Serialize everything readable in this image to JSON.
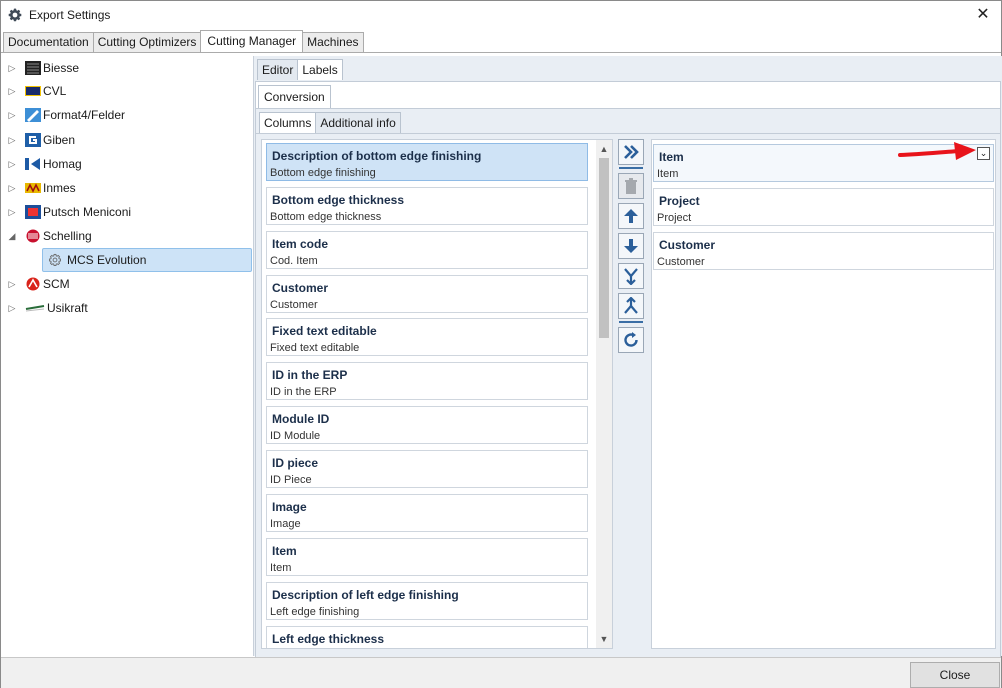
{
  "window": {
    "title": "Export Settings"
  },
  "top_tabs": [
    "Documentation",
    "Cutting Optimizers",
    "Cutting Manager",
    "Machines"
  ],
  "top_tab_active": "Cutting Manager",
  "tree": {
    "items": [
      {
        "label": "Biesse"
      },
      {
        "label": "CVL"
      },
      {
        "label": "Format4/Felder"
      },
      {
        "label": "Giben"
      },
      {
        "label": "Homag"
      },
      {
        "label": "Inmes"
      },
      {
        "label": "Putsch Meniconi"
      },
      {
        "label": "Schelling"
      },
      {
        "label": "MCS Evolution"
      },
      {
        "label": "SCM"
      },
      {
        "label": "Usikraft"
      }
    ]
  },
  "sub_tabs": [
    "Editor",
    "Labels"
  ],
  "conversion_tab": "Conversion",
  "column_tabs": [
    "Columns",
    "Additional info"
  ],
  "available_columns": [
    {
      "title": "Description of bottom edge finishing",
      "subtitle": "Bottom edge finishing"
    },
    {
      "title": "Bottom edge thickness",
      "subtitle": "Bottom edge thickness"
    },
    {
      "title": "Item code",
      "subtitle": "Cod. Item"
    },
    {
      "title": "Customer",
      "subtitle": "Customer"
    },
    {
      "title": "Fixed text editable",
      "subtitle": "Fixed text editable"
    },
    {
      "title": "ID in the ERP",
      "subtitle": "ID in the ERP"
    },
    {
      "title": "Module ID",
      "subtitle": "ID Module"
    },
    {
      "title": "ID piece",
      "subtitle": "ID Piece"
    },
    {
      "title": "Image",
      "subtitle": "Image"
    },
    {
      "title": "Item",
      "subtitle": "Item"
    },
    {
      "title": "Description of left edge finishing",
      "subtitle": "Left edge finishing"
    },
    {
      "title": "Left edge thickness",
      "subtitle": ""
    }
  ],
  "selected_columns": [
    {
      "title": "Item",
      "subtitle": "Item"
    },
    {
      "title": "Project",
      "subtitle": "Project"
    },
    {
      "title": "Customer",
      "subtitle": "Customer"
    }
  ],
  "expand_glyph": "⌄",
  "footer": {
    "close_label": "Close"
  },
  "colors": {
    "accent": "#3a6ea5",
    "selection": "#cfe3f6",
    "annotation": "#e8141b"
  }
}
